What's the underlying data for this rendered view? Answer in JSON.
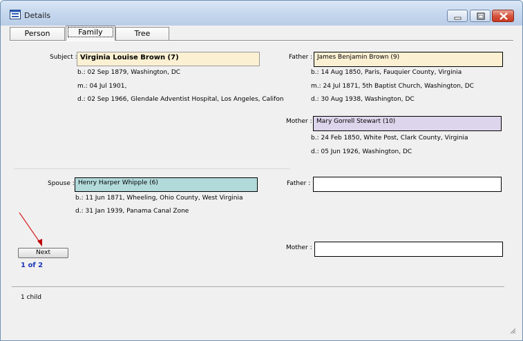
{
  "window": {
    "title": "Details"
  },
  "tabs": [
    {
      "label": "Person"
    },
    {
      "label": "Family"
    },
    {
      "label": "Tree"
    }
  ],
  "subject": {
    "label": "Subject :",
    "name": "Virginia Louise Brown (7)",
    "birth": "b.: 02 Sep 1879, Washington, DC",
    "marriage": "m.: 04 Jul 1901,",
    "death": "d.: 02 Sep 1966, Glendale Adventist Hospital, Los Angeles, Califon",
    "color": "#fbf0d2"
  },
  "subject_father": {
    "label": "Father :",
    "name": "James Benjamin Brown (9)",
    "birth": "b.: 14 Aug 1850, Paris, Fauquier County, Virginia",
    "marriage": "m.: 24 Jul 1871, 5th Baptist Church, Washington, DC",
    "death": "d.: 30 Aug 1938, Washington, DC",
    "color": "#fbf0d2"
  },
  "subject_mother": {
    "label": "Mother :",
    "name": "Mary Gorrell Stewart (10)",
    "birth": "b.: 24 Feb 1850, White Post, Clark County, Virginia",
    "death": "d.: 05 Jun 1926, Washington, DC",
    "color": "#ddd5eb"
  },
  "spouse": {
    "label": "Spouse :",
    "name": "Henry Harper Whipple (6)",
    "birth": "b.: 11 Jun 1871, Wheeling, Ohio County, West Virginia",
    "death": "d.: 31 Jan 1939, Panama Canal Zone",
    "color": "#b2dadb"
  },
  "spouse_father": {
    "label": "Father :",
    "name": ""
  },
  "spouse_mother": {
    "label": "Mother :",
    "name": ""
  },
  "pager": {
    "next_label": "Next",
    "position": "1 of 2"
  },
  "status": {
    "children": "1 child"
  }
}
